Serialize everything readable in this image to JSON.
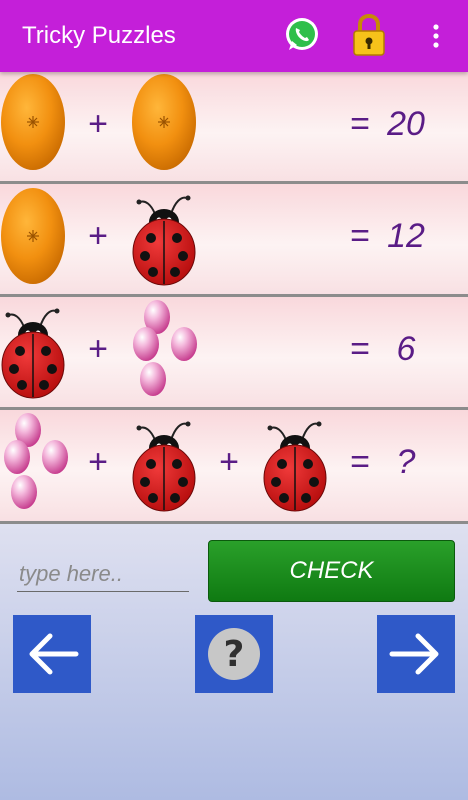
{
  "app_bar": {
    "title": "Tricky Puzzles",
    "icons": [
      "whatsapp-icon",
      "lock-icon",
      "more-vert-icon"
    ],
    "color": "#c41fd9"
  },
  "puzzle": {
    "rows": [
      {
        "items": [
          "orange",
          "orange"
        ],
        "operators": [
          "+"
        ],
        "equals": "=",
        "result": "20"
      },
      {
        "items": [
          "orange",
          "ladybug"
        ],
        "operators": [
          "+"
        ],
        "equals": "=",
        "result": "12"
      },
      {
        "items": [
          "ladybug",
          "pink-beads"
        ],
        "operators": [
          "+"
        ],
        "equals": "=",
        "result": "6"
      },
      {
        "items": [
          "pink-beads",
          "ladybug",
          "ladybug"
        ],
        "operators": [
          "+",
          "+"
        ],
        "equals": "=",
        "result": "?"
      }
    ]
  },
  "answer": {
    "placeholder": "type here..",
    "value": ""
  },
  "check_button": {
    "label": "CHECK",
    "color": "#1a8c1c"
  },
  "nav": {
    "prev_icon": "arrow-left-icon",
    "hint_icon": "question-icon",
    "next_icon": "arrow-right-icon",
    "color": "#2f59c8"
  }
}
